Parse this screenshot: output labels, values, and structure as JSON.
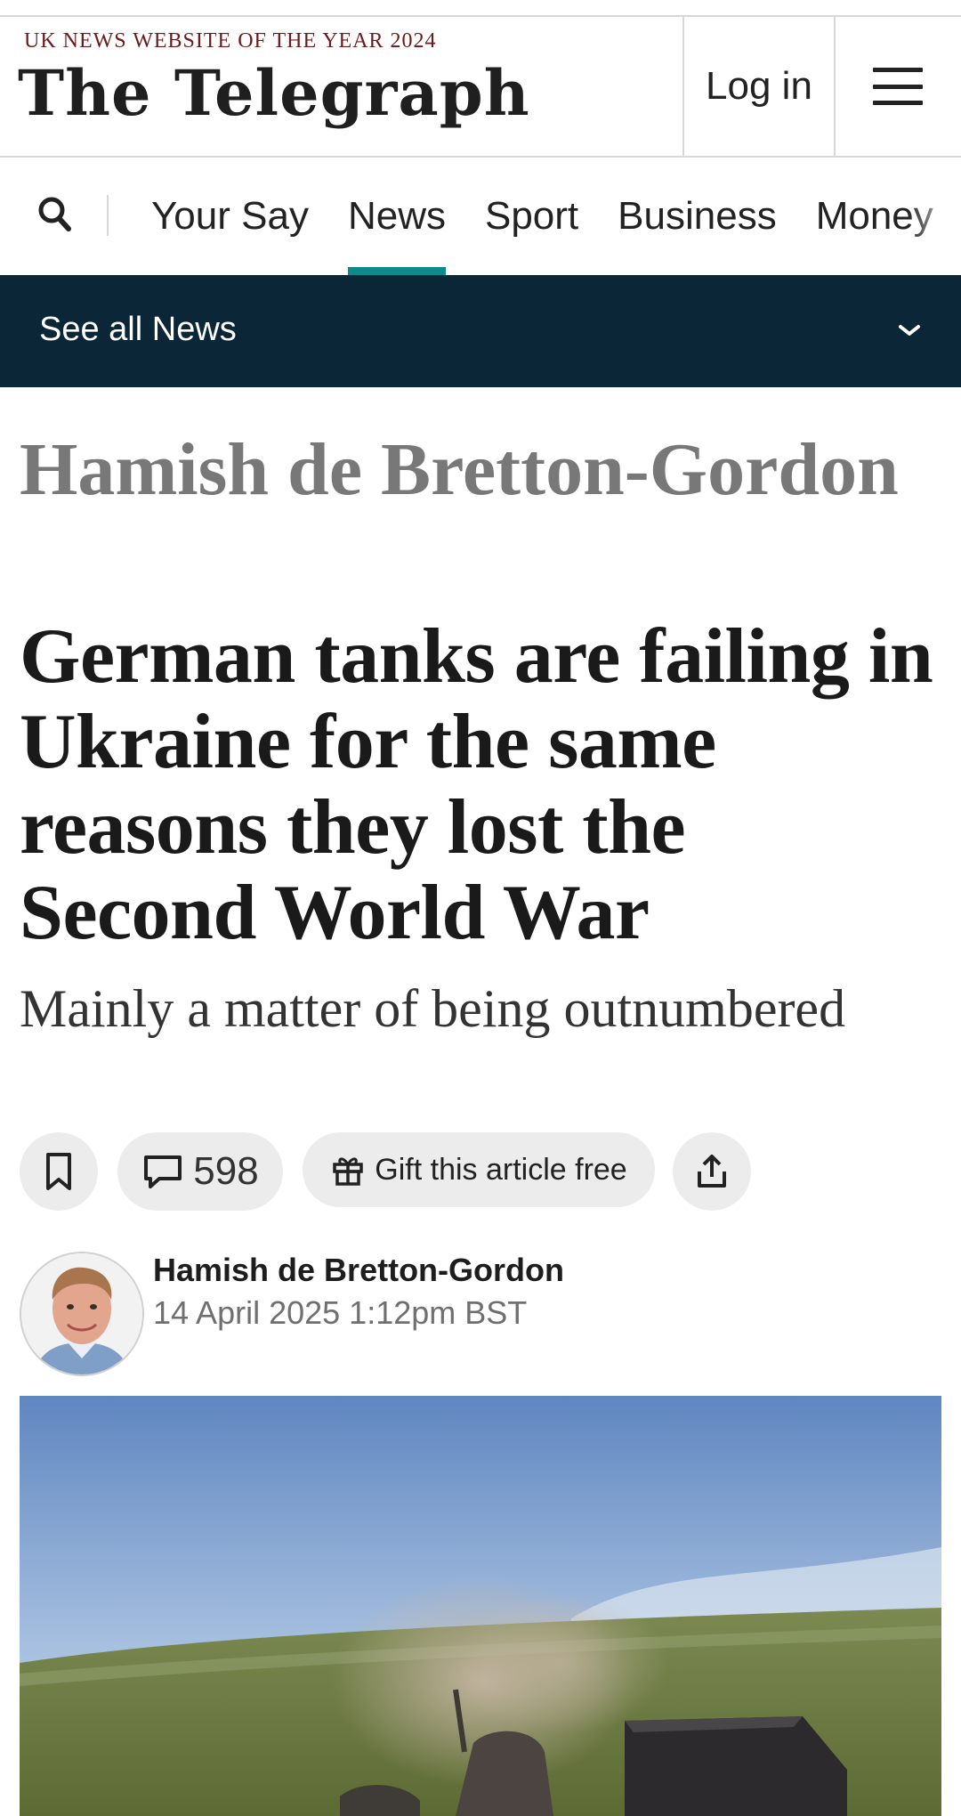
{
  "masthead": {
    "award": "UK NEWS WEBSITE OF THE YEAR 2024",
    "logo": "The Telegraph",
    "login_label": "Log in",
    "menu_icon": "hamburger-menu-icon"
  },
  "nav": {
    "search_icon": "search-icon",
    "tabs": [
      {
        "label": "Your Say"
      },
      {
        "label": "News",
        "active": true
      },
      {
        "label": "Sport"
      },
      {
        "label": "Business"
      },
      {
        "label": "Money"
      }
    ],
    "accent_color": "#0f8a8a"
  },
  "section_bar": {
    "label": "See all News",
    "icon": "chevron-down-icon",
    "background": "#0b2636"
  },
  "article": {
    "kicker": "Hamish de Bretton-Gordon",
    "headline": "German tanks are failing in Ukraine for the same reasons they lost the Second World War",
    "standfirst": "Mainly a matter of being outnumbered",
    "actions": {
      "bookmark_icon": "bookmark-icon",
      "comment_icon": "comment-icon",
      "comment_count": "598",
      "gift_icon": "gift-icon",
      "gift_label": "Gift this article free",
      "share_icon": "share-icon"
    },
    "author": {
      "name": "Hamish de Bretton-Gordon",
      "date": "14 April 2025 1:12pm BST"
    }
  }
}
